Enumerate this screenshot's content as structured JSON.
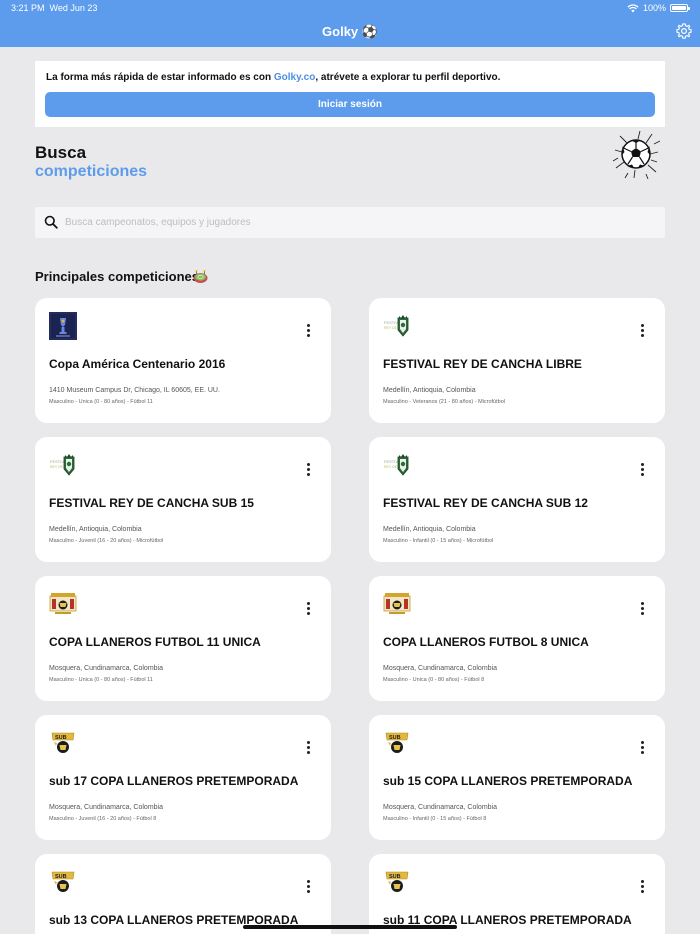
{
  "status": {
    "time": "3:21 PM",
    "date": "Wed Jun 23",
    "battery": "100%"
  },
  "app": {
    "title": "Golky ⚽"
  },
  "login": {
    "text_before": "La forma más rápida de estar informado es con ",
    "brand": "Golky.co",
    "text_after": ", atrévete a explorar tu perfil deportivo.",
    "button": "Iniciar sesión"
  },
  "hero": {
    "line1": "Busca",
    "line2": "competiciones"
  },
  "search": {
    "placeholder": "Busca campeonatos, equipos y jugadores",
    "value": ""
  },
  "section": {
    "title": "Principales competiciones"
  },
  "competitions": [
    {
      "title": "Copa América Centenario 2016",
      "location": "1410 Museum Campus Dr, Chicago, IL 60605, EE. UU.",
      "category": "Masculino - Unica (0 - 80 años) - Fútbol 11",
      "logo": "copa-america-logo"
    },
    {
      "title": "FESTIVAL REY DE CANCHA  LIBRE",
      "location": "Medellín, Antioquia, Colombia",
      "category": "Masculino - Veteranos (21 - 80 años) - Microfútbol",
      "logo": "rey-de-cancha-logo"
    },
    {
      "title": "FESTIVAL REY DE CANCHA SUB 15",
      "location": "Medellín, Antioquia, Colombia",
      "category": "Masculino - Juvenil (16 - 20 años) - Microfútbol",
      "logo": "rey-de-cancha-logo"
    },
    {
      "title": "FESTIVAL REY DE CANCHA SUB 12",
      "location": "Medellín, Antioquia, Colombia",
      "category": "Masculino - Infantil (0 - 15 años) - Microfútbol",
      "logo": "rey-de-cancha-logo"
    },
    {
      "title": "COPA LLANEROS FUTBOL 11 UNICA",
      "location": "Mosquera, Cundinamarca, Colombia",
      "category": "Masculino - Unica (0 - 80 años) - Fútbol 11",
      "logo": "llaneros-logo"
    },
    {
      "title": "COPA LLANEROS FUTBOL 8 UNICA",
      "location": "Mosquera, Cundinamarca, Colombia",
      "category": "Masculino - Unica (0 - 80 años) - Fútbol 8",
      "logo": "llaneros-logo"
    },
    {
      "title": "sub 17 COPA LLANEROS PRETEMPORADA",
      "location": "Mosquera, Cundinamarca, Colombia",
      "category": "Masculino - Juvenil (16 - 20 años) - Fútbol 8",
      "logo": "llaneros-sub-logo"
    },
    {
      "title": "sub 15 COPA LLANEROS PRETEMPORADA",
      "location": "Mosquera, Cundinamarca, Colombia",
      "category": "Masculino - Infantil (0 - 15 años) - Fútbol 8",
      "logo": "llaneros-sub-logo"
    },
    {
      "title": "sub 13 COPA LLANEROS PRETEMPORADA",
      "location": "",
      "category": "",
      "logo": "llaneros-sub-logo"
    },
    {
      "title": "sub 11 COPA LLANEROS PRETEMPORADA",
      "location": "",
      "category": "",
      "logo": "llaneros-sub-logo"
    }
  ],
  "colors": {
    "accent": "#5d9cec",
    "brand_link": "#4c8fe6",
    "background": "#e9e9eb"
  }
}
